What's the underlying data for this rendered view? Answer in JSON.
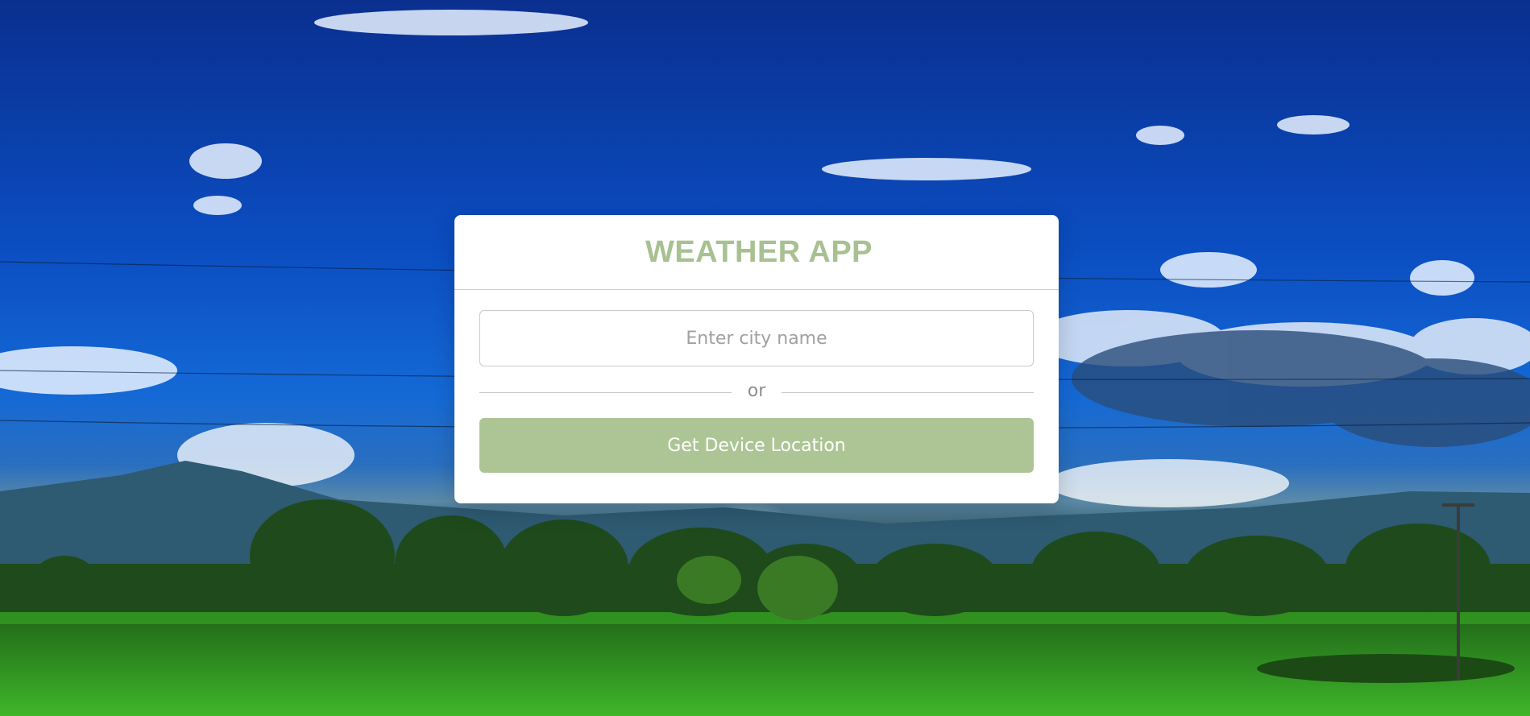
{
  "app": {
    "title": "WEATHER APP"
  },
  "search": {
    "value": "",
    "placeholder": "Enter city name"
  },
  "divider": {
    "label": "or"
  },
  "location_button": {
    "label": "Get Device Location"
  },
  "colors": {
    "accent": "#adc595",
    "title": "#a7c191",
    "card_background": "#ffffff"
  }
}
